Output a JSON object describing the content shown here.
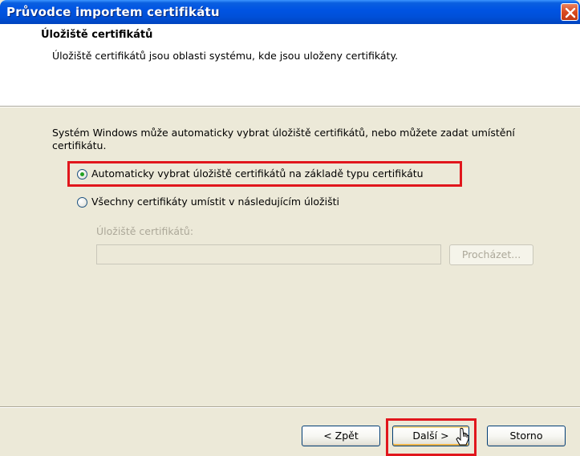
{
  "window": {
    "title": "Průvodce importem certifikátu"
  },
  "header": {
    "title": "Úložiště certifikátů",
    "subtitle": "Úložiště certifikátů jsou oblasti systému, kde jsou uloženy certifikáty."
  },
  "body": {
    "description": "Systém Windows může automaticky vybrat úložiště certifikátů, nebo můžete zadat umístění certifikátu.",
    "options": [
      {
        "label": "Automaticky vybrat úložiště certifikátů na základě typu certifikátu",
        "selected": true
      },
      {
        "label": "Všechny certifikáty umístit v následujícím úložišti",
        "selected": false
      }
    ],
    "store": {
      "label": "Úložiště certifikátů:",
      "value": "",
      "browse_label": "Procházet..."
    }
  },
  "footer": {
    "back_label": "< Zpět",
    "next_label": "Další >",
    "cancel_label": "Storno"
  },
  "icons": {
    "close": "close-icon",
    "radio_selected": "radio-selected-icon",
    "radio_unselected": "radio-unselected-icon",
    "cursor": "mouse-cursor-icon"
  },
  "colors": {
    "titlebar": "#0054e3",
    "highlight": "#e1161c",
    "radio_dot": "#21a121",
    "dialog_bg": "#ece9d8"
  }
}
